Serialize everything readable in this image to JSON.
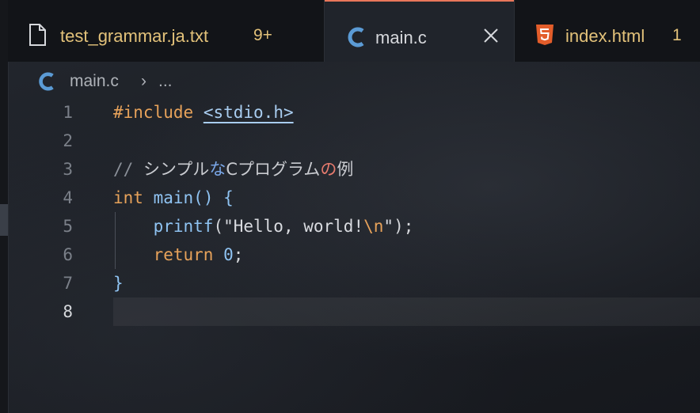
{
  "tabs": [
    {
      "label": "test_grammar.ja.txt",
      "badge": "9+",
      "icon": "file-icon"
    },
    {
      "label": "main.c",
      "icon": "c-language-icon",
      "active": true,
      "close": "×"
    },
    {
      "label": "index.html",
      "badge": "1",
      "icon": "html5-icon"
    }
  ],
  "breadcrumb": {
    "file": "main.c",
    "separator": "›",
    "more": "..."
  },
  "editor": {
    "active_line": 8,
    "line_numbers": [
      "1",
      "2",
      "3",
      "4",
      "5",
      "6",
      "7",
      "8"
    ],
    "lines": {
      "l1": {
        "directive": "#include",
        "space": " ",
        "header": "<stdio.h>"
      },
      "l3": {
        "slashes": "// ",
        "a": "シンプル",
        "b": "な",
        "c": "Cプログラム",
        "d": "の",
        "e": "例"
      },
      "l4": {
        "type": "int",
        "space": " ",
        "name": "main",
        "parens": "()",
        "space2": " ",
        "brace": "{"
      },
      "l5": {
        "indent": "    ",
        "fn": "printf",
        "open": "(",
        "str1": "\"Hello, world!",
        "esc": "\\n",
        "str2": "\"",
        "close": ");"
      },
      "l6": {
        "indent": "    ",
        "kw": "return",
        "space": " ",
        "num": "0",
        "semi": ";"
      },
      "l7": {
        "brace": "}"
      }
    }
  },
  "colors": {
    "accent_tab": "#e9775a",
    "c_icon": "#5b9bd5",
    "html_icon": "#e35d2a",
    "warning": "#e3c27a"
  }
}
